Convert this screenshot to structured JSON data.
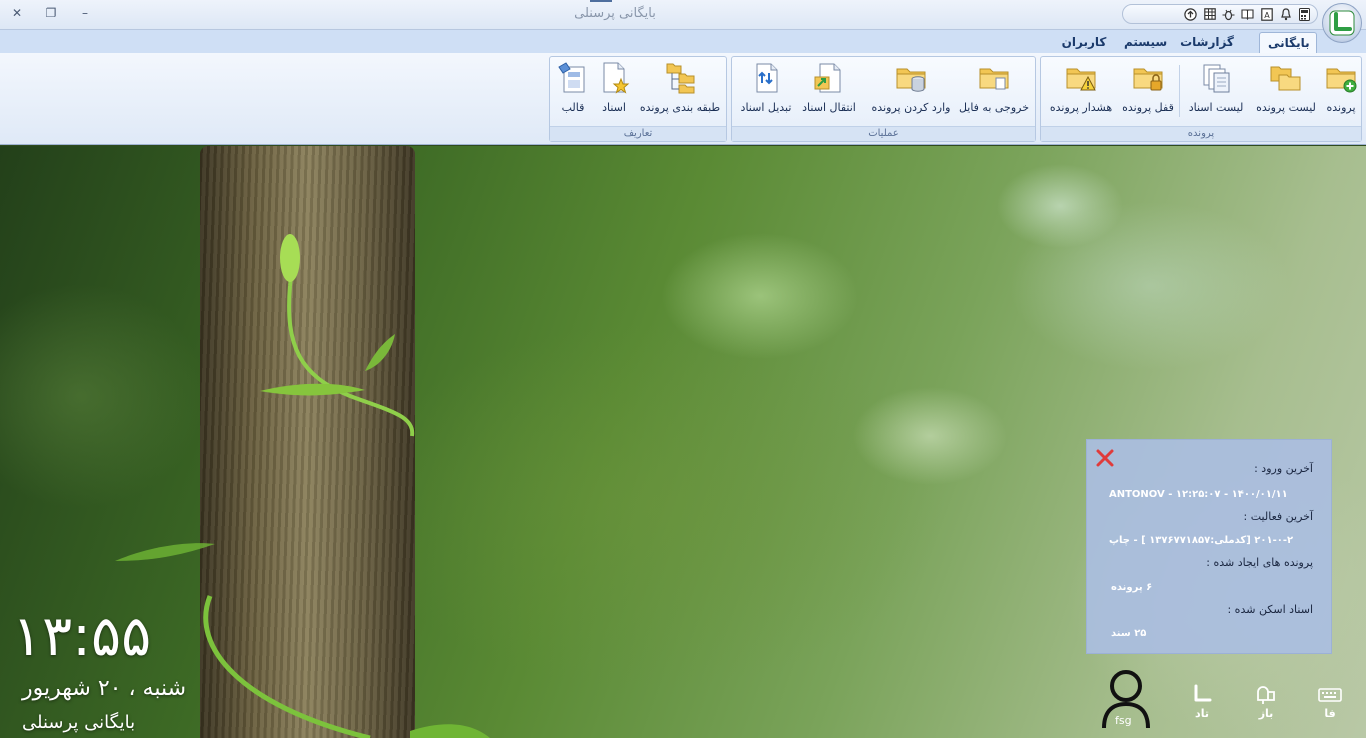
{
  "window": {
    "title": "بایگانی پرسنلی",
    "close_glyph": "✕",
    "restore_glyph": "❐",
    "minimize_glyph": "–"
  },
  "quick_access": {
    "icons": [
      "calculator-icon",
      "bell-icon",
      "contact-card-icon",
      "book-icon",
      "bug-icon",
      "spreadsheet-icon",
      "upload-icon"
    ],
    "dropdown_glyph": "▾"
  },
  "tabs": [
    {
      "label": "بایگانی",
      "active": true
    },
    {
      "label": "گزارشات",
      "active": false
    },
    {
      "label": "سیستم",
      "active": false
    },
    {
      "label": "کاربران",
      "active": false
    }
  ],
  "ribbon": {
    "groups": [
      {
        "label": "پرونده"
      },
      {
        "label": "عملیات"
      },
      {
        "label": "تعاریف"
      }
    ],
    "buttons": {
      "file": "پرونده",
      "file_list": "لیست پرونده",
      "doc_list": "لیست اسناد",
      "lock_file": "قفل پرونده",
      "file_alert": "هشدار پرونده",
      "export_file": "خروجی به فایل",
      "import_file": "وارد کردن پرونده",
      "transfer_docs": "انتقال اسناد",
      "convert_docs": "تبدیل اسناد",
      "classify_file": "طبقه بندی پرونده",
      "documents": "اسناد",
      "template": "قالب"
    }
  },
  "desktop": {
    "clock": "۱۳:۵۵",
    "date": "شنبه ، ۲۰ شهریور",
    "app_name": "بایگانی پرسنلی"
  },
  "info_panel": {
    "last_login_label": "آخرین ورود :",
    "last_login_value": "ANTONOV - ۱۲:۲۵:۰۷ - ۱۴۰۰/۰۱/۱۱",
    "last_activity_label": "آخرین فعالیت :",
    "last_activity_value": "۲۰۱-۰-۲ [کدملی:۱۳۷۶۷۷۱۸۵۷ ] - چاپ",
    "created_files_label": "پرونده های ایجاد شده :",
    "created_files_value": "۶ پرونده",
    "scanned_docs_label": "اسناد اسکن شده :",
    "scanned_docs_value": "۲۵ سند"
  },
  "tray": {
    "user_name": "fsg",
    "tad": "تاد",
    "baz": "باز",
    "lang": "فا"
  },
  "colors": {
    "ribbon_text": "#1b2f55",
    "tab_text": "#1b3a6b",
    "close_red": "#e03b3b",
    "folder_yellow": "#f2c654"
  }
}
